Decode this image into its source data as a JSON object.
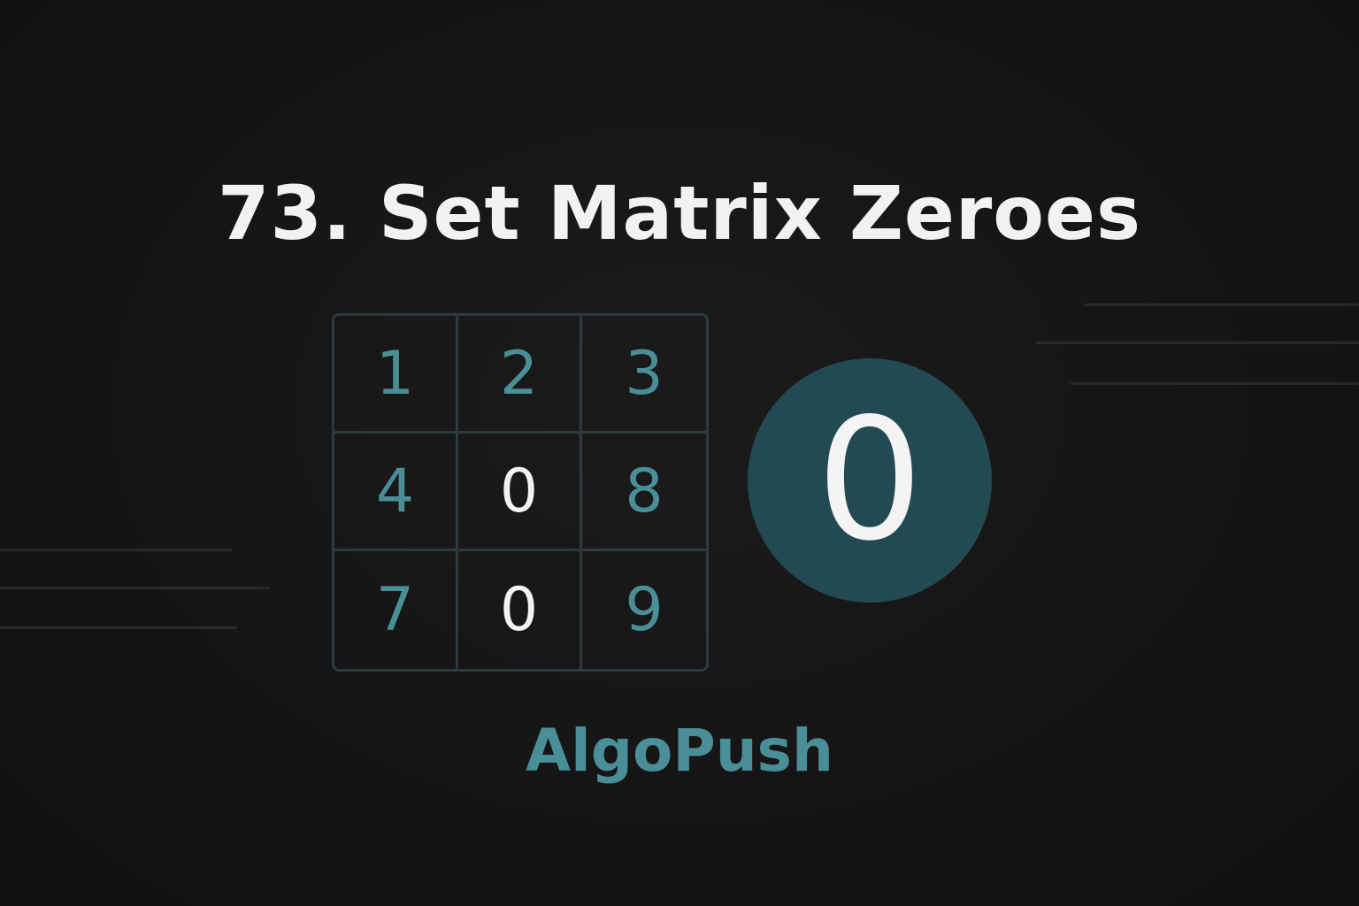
{
  "title": "73. Set Matrix Zeroes",
  "matrix": [
    [
      "1",
      "2",
      "3"
    ],
    [
      "4",
      "0",
      "8"
    ],
    [
      "7",
      "0",
      "9"
    ]
  ],
  "highlight_value": "0",
  "brand": "AlgoPush",
  "colors": {
    "background": "#141414",
    "title_text": "#f2f2f2",
    "accent_teal": "#4a8f98",
    "grid_line": "#2d3b3e",
    "circle_fill": "#234a52",
    "zero_text": "#f2f2f2"
  }
}
